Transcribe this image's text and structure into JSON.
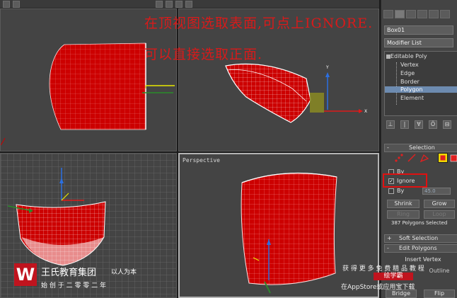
{
  "annotation": {
    "line1": "在顶视图选取表面,可点上IGNORE.",
    "line2": "可以直接选取正面."
  },
  "viewports": {
    "perspective_label": "Perspective"
  },
  "command_panel": {
    "object_name": "Box01",
    "modifier_list": "Modifier List",
    "stack": {
      "root": "Editable Poly",
      "items": [
        "Vertex",
        "Edge",
        "Border",
        "Polygon",
        "Element"
      ],
      "selected_index": 3
    },
    "selection": {
      "title": "Selection",
      "by_vertex": "By",
      "ignore": "Ignore",
      "ignore_checked": true,
      "by_angle": "By",
      "angle_value": "45.0",
      "shrink": "Shrink",
      "grow": "Grow",
      "ring": "Ring",
      "loop": "Loop",
      "status": "387 Polygons Selected"
    },
    "soft_selection": {
      "sign": "+",
      "title": "Soft Selection"
    },
    "edit_polygons": {
      "sign": "-",
      "title": "Edit Polygons",
      "insert_vertex": "Insert Vertex",
      "outline": "Outline",
      "bridge": "Bridge",
      "flip": "Flip"
    }
  },
  "watermark": {
    "company": "王氏教育集团",
    "slogan": "以人为本",
    "motto": "始 创 于 二 零 零 二 年",
    "promo_line1": "获 得 更 多 免 费 精 品 教 程",
    "promo_badge": "绘学霸",
    "promo_line2": "在AppStore或应用宝下载"
  },
  "colors": {
    "mesh_red": "#cc0000",
    "mesh_wire": "#ffffff",
    "viewport_bg": "#444444",
    "annotation_red": "#d81a1a",
    "selection_highlight": "#6d8bb0"
  }
}
